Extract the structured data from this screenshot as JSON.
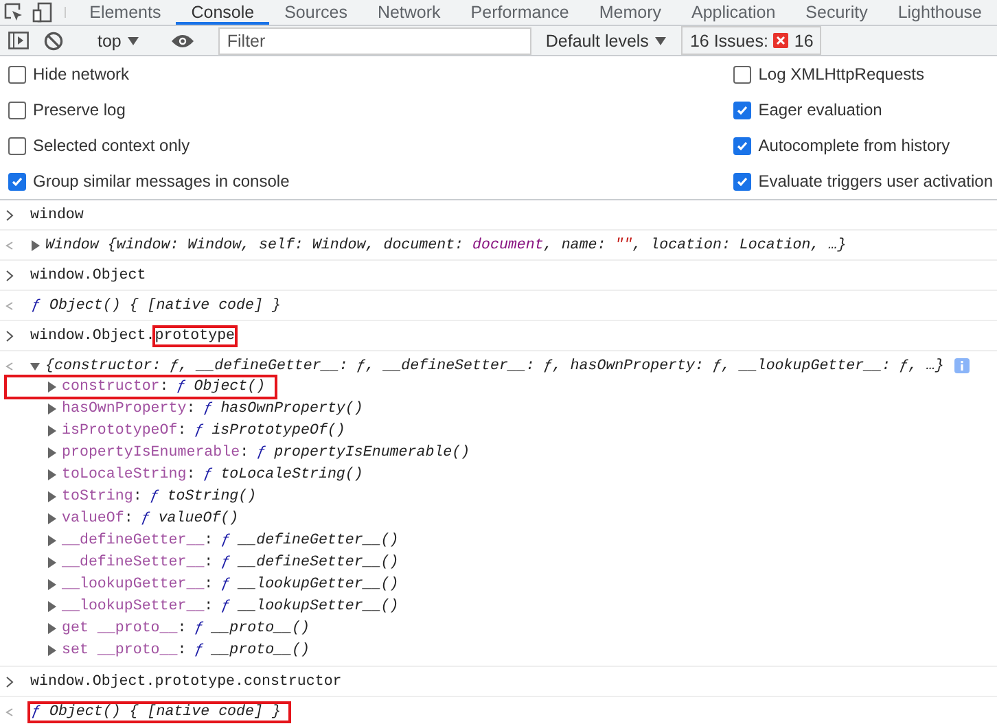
{
  "tabs": [
    {
      "label": "Elements",
      "selected": false
    },
    {
      "label": "Console",
      "selected": true
    },
    {
      "label": "Sources",
      "selected": false
    },
    {
      "label": "Network",
      "selected": false
    },
    {
      "label": "Performance",
      "selected": false
    },
    {
      "label": "Memory",
      "selected": false
    },
    {
      "label": "Application",
      "selected": false
    },
    {
      "label": "Security",
      "selected": false
    },
    {
      "label": "Lighthouse",
      "selected": false
    }
  ],
  "toolbar": {
    "context": "top",
    "filter": {
      "placeholder": "Filter"
    },
    "levels": "Default levels",
    "issues_label": "16 Issues:",
    "issues_count": "16"
  },
  "settings": {
    "left": [
      {
        "label": "Hide network",
        "checked": false
      },
      {
        "label": "Preserve log",
        "checked": false
      },
      {
        "label": "Selected context only",
        "checked": false
      },
      {
        "label": "Group similar messages in console",
        "checked": true
      }
    ],
    "right": [
      {
        "label": "Log XMLHttpRequests",
        "checked": false
      },
      {
        "label": "Eager evaluation",
        "checked": true
      },
      {
        "label": "Autocomplete from history",
        "checked": true
      },
      {
        "label": "Evaluate triggers user activation",
        "checked": true
      }
    ]
  },
  "console": [
    {
      "kind": "input",
      "segments": [
        {
          "t": "window",
          "highlighted": false
        }
      ]
    },
    {
      "kind": "object",
      "expanded": false,
      "segments": [
        {
          "t": "Window {window: Window, self: Window, document: ",
          "kind": "plain"
        },
        {
          "t": "document",
          "kind": "node"
        },
        {
          "t": ", name: ",
          "kind": "plain"
        },
        {
          "t": "\"\"",
          "kind": "string"
        },
        {
          "t": ", location: Location, …}",
          "kind": "plain"
        }
      ]
    },
    {
      "kind": "input",
      "segments": [
        {
          "t": "window.Object",
          "highlighted": false
        }
      ]
    },
    {
      "kind": "function",
      "highlighted": false,
      "fn": "ƒ",
      "text": "Object() { [native code] }"
    },
    {
      "kind": "input",
      "segments": [
        {
          "t": "window.Object.",
          "highlighted": false
        },
        {
          "t": "prototype",
          "highlighted": true
        }
      ]
    },
    {
      "kind": "object",
      "expanded": true,
      "info": true,
      "separator": ":",
      "segments": [
        {
          "t": "{constructor: ƒ, __defineGetter__: ƒ, __defineSetter__: ƒ, hasOwnProperty: ƒ, __lookupGetter__: ƒ, …}",
          "kind": "plain"
        }
      ],
      "children": [
        {
          "key": "constructor",
          "fn": "ƒ",
          "value": "Object()",
          "expanded": false,
          "highlighted": true
        },
        {
          "key": "hasOwnProperty",
          "fn": "ƒ",
          "value": "hasOwnProperty()",
          "expanded": false,
          "highlighted": false
        },
        {
          "key": "isPrototypeOf",
          "fn": "ƒ",
          "value": "isPrototypeOf()",
          "expanded": false,
          "highlighted": false
        },
        {
          "key": "propertyIsEnumerable",
          "fn": "ƒ",
          "value": "propertyIsEnumerable()",
          "expanded": false,
          "highlighted": false
        },
        {
          "key": "toLocaleString",
          "fn": "ƒ",
          "value": "toLocaleString()",
          "expanded": false,
          "highlighted": false
        },
        {
          "key": "toString",
          "fn": "ƒ",
          "value": "toString()",
          "expanded": false,
          "highlighted": false
        },
        {
          "key": "valueOf",
          "fn": "ƒ",
          "value": "valueOf()",
          "expanded": false,
          "highlighted": false
        },
        {
          "key": "__defineGetter__",
          "fn": "ƒ",
          "value": "__defineGetter__()",
          "expanded": false,
          "highlighted": false
        },
        {
          "key": "__defineSetter__",
          "fn": "ƒ",
          "value": "__defineSetter__()",
          "expanded": false,
          "highlighted": false
        },
        {
          "key": "__lookupGetter__",
          "fn": "ƒ",
          "value": "__lookupGetter__()",
          "expanded": false,
          "highlighted": false
        },
        {
          "key": "__lookupSetter__",
          "fn": "ƒ",
          "value": "__lookupSetter__()",
          "expanded": false,
          "highlighted": false
        },
        {
          "key": "get __proto__",
          "fn": "ƒ",
          "value": "__proto__()",
          "expanded": false,
          "highlighted": false
        },
        {
          "key": "set __proto__",
          "fn": "ƒ",
          "value": "__proto__()",
          "expanded": false,
          "highlighted": false
        }
      ]
    },
    {
      "kind": "input",
      "segments": [
        {
          "t": "window.Object.prototype.constructor",
          "highlighted": false
        }
      ]
    },
    {
      "kind": "function",
      "highlighted": true,
      "fn": "ƒ",
      "text": "Object() { [native code] }"
    }
  ]
}
